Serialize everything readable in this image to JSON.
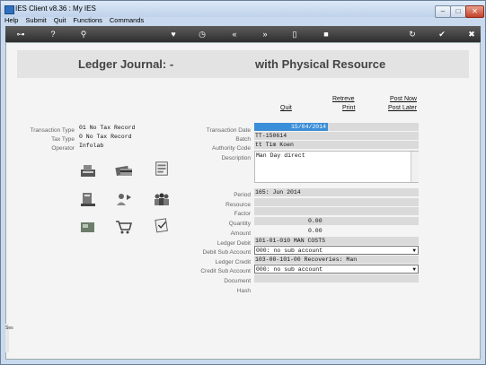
{
  "window": {
    "title": "IES Client v8.36 : My IES"
  },
  "menu": [
    "Help",
    "Submit",
    "Quit",
    "Functions",
    "Commands"
  ],
  "header": {
    "title_left": "Ledger Journal: -",
    "title_right": "with Physical Resource"
  },
  "actions": {
    "quit": "Quit",
    "retrieve": "Retreve",
    "print": "Print",
    "post_now": "Post Now",
    "post_later": "Post Later"
  },
  "left_panel": {
    "transaction_type_label": "Transaction Type",
    "transaction_type_value": "01 No Tax Record",
    "tax_type_label": "Tax Type",
    "tax_type_value": "0 No Tax Record",
    "operator_label": "Operator",
    "operator_value": "Infolab"
  },
  "form": {
    "transaction_date_label": "Transaction Date",
    "transaction_date": "15/04/2014",
    "batch_label": "Batch",
    "batch": "TT-150614",
    "authority_code_label": "Authority Code",
    "authority_code": "tt Tim Koen",
    "description_label": "Description",
    "description": "Man Day direct",
    "period_label": "Period",
    "period": "165: Jun 2014",
    "resource_label": "Resource",
    "resource": "",
    "factor_label": "Factor",
    "factor": "",
    "quantity_label": "Quantity",
    "quantity": "0.00",
    "amount_label": "Amount",
    "amount": "0.00",
    "ledger_debit_label": "Ledger Debit",
    "ledger_debit": "101-01-010 MAN COSTS",
    "debit_sub_account_label": "Debit Sub Account",
    "debit_sub_account": "000: no sub account",
    "ledger_credit_label": "Ledger Credit",
    "ledger_credit": "103-00-101-00 Recoveries: Man",
    "credit_sub_account_label": "Credit Sub Account",
    "credit_sub_account": "000: no sub account",
    "document_label": "Document",
    "document": "",
    "hash_label": "Hash",
    "hash": ""
  },
  "side_text": "Ses"
}
